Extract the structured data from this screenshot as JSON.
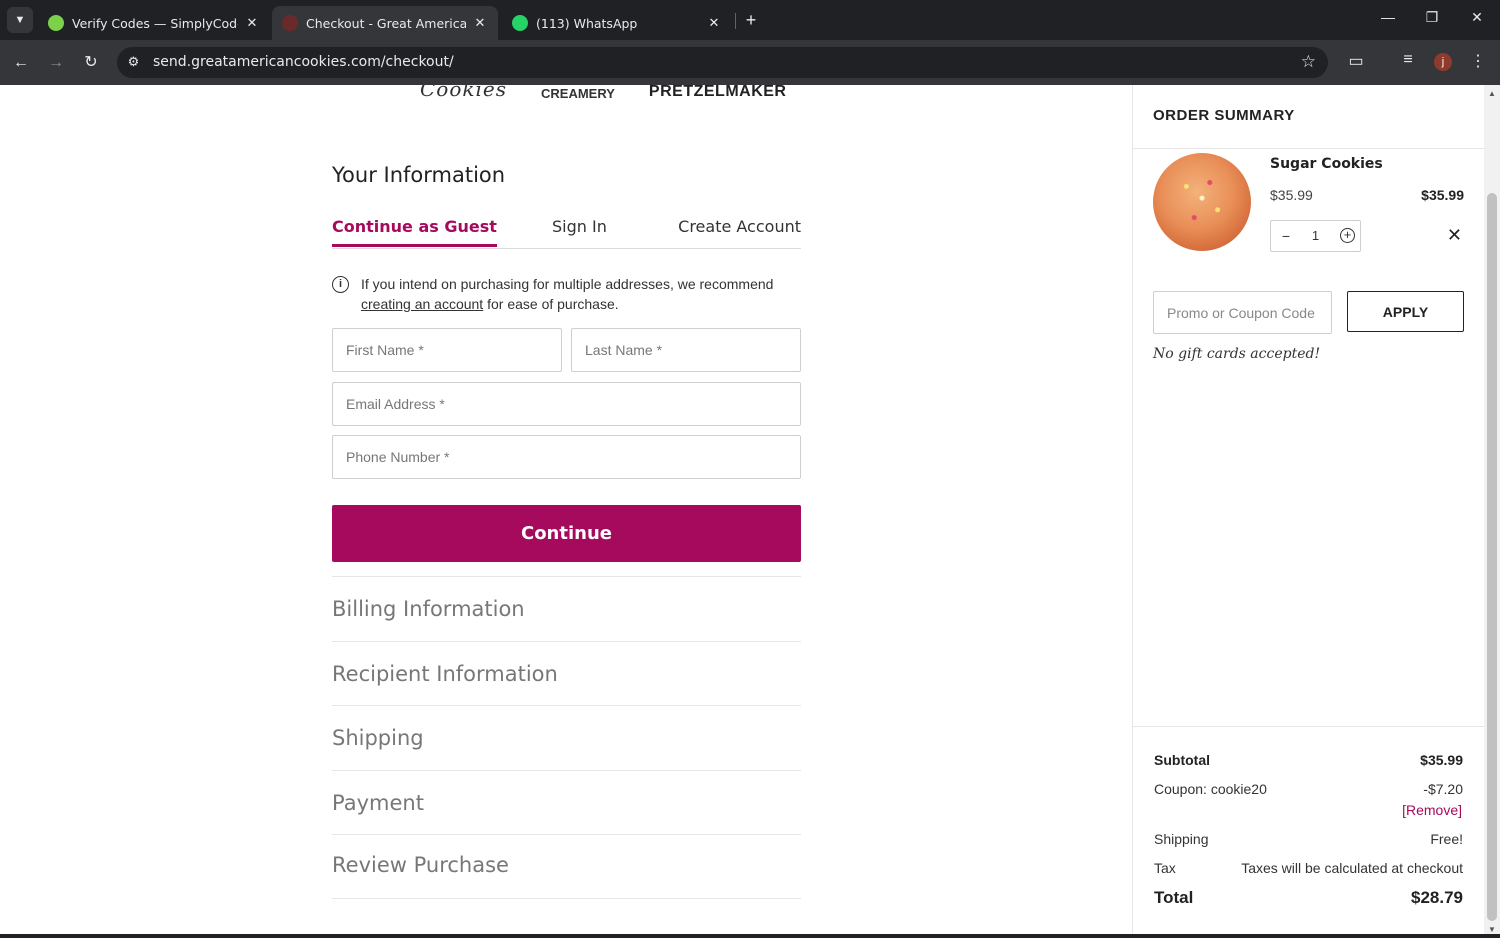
{
  "browser": {
    "tabs": [
      {
        "title": "Verify Codes — SimplyCodes",
        "active": false,
        "favicon_color": "#7bd14a"
      },
      {
        "title": "Checkout - Great American Cookies",
        "active": true,
        "favicon_color": "#6b2a2a"
      },
      {
        "title": "(113) WhatsApp",
        "active": false,
        "favicon_color": "#25d366"
      }
    ],
    "url": "send.greatamericancookies.com/checkout/",
    "profile_initial": "j"
  },
  "brands": {
    "cookies": "Cookies",
    "creamery": "CREAMERY",
    "pretzel": "PRETZELMAKER"
  },
  "checkout": {
    "section_title": "Your Information",
    "tabs": [
      "Continue as Guest",
      "Sign In",
      "Create Account"
    ],
    "info_note_before": "If you intend on purchasing for multiple addresses, we recommend ",
    "info_note_link": "creating an account",
    "info_note_after": " for ease of purchase.",
    "fields": {
      "first_name": "First Name *",
      "last_name": "Last Name *",
      "email": "Email Address *",
      "phone": "Phone Number *"
    },
    "continue_label": "Continue",
    "steps": [
      "Billing Information",
      "Recipient Information",
      "Shipping",
      "Payment",
      "Review Purchase"
    ]
  },
  "summary": {
    "title": "ORDER SUMMARY",
    "item": {
      "name": "Sugar Cookies",
      "price": "$35.99",
      "line_total": "$35.99",
      "quantity": "1"
    },
    "promo_placeholder": "Promo or Coupon Code",
    "apply_label": "APPLY",
    "no_gift_cards": "No gift cards accepted!",
    "totals": {
      "subtotal_label": "Subtotal",
      "subtotal_value": "$35.99",
      "coupon_label": "Coupon: cookie20",
      "coupon_value": "-$7.20",
      "remove_label": "[Remove]",
      "shipping_label": "Shipping",
      "shipping_value": "Free!",
      "tax_label": "Tax",
      "tax_value": "Taxes will be calculated at checkout",
      "total_label": "Total",
      "total_value": "$28.79"
    }
  },
  "colors": {
    "brand": "#a50a5c"
  }
}
